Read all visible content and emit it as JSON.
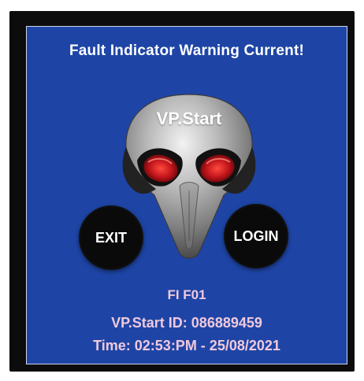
{
  "screen": {
    "title": "Fault Indicator Warning Current!",
    "logo_text": "VP.Start",
    "buttons": {
      "exit_label": "EXIT",
      "login_label": "LOGIN"
    },
    "fault_code": "FI F01",
    "device_id": "VP.Start ID: 086889459",
    "time": "Time: 02:53:PM - 25/08/2021"
  },
  "colors": {
    "background": "#1e45a6",
    "frame": "#0c0c0c",
    "info_text": "#f0c9dd",
    "eye_red": "#c0141b"
  },
  "icons": {
    "mascot": "skull-mascot-icon"
  }
}
